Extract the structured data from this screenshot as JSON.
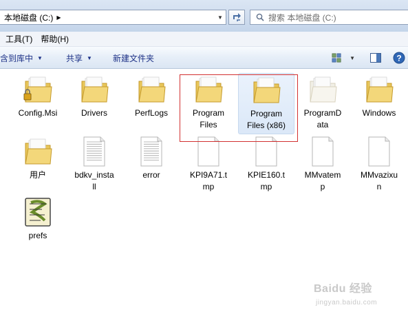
{
  "address": {
    "path": "本地磁盘 (C:)",
    "search_placeholder": "搜索 本地磁盘 (C:)"
  },
  "menu": {
    "items": [
      {
        "label": "工具(T)"
      },
      {
        "label": "帮助(H)"
      }
    ]
  },
  "toolbar": {
    "include_label": "包含到库中",
    "share_label": "共享",
    "new_folder_label": "新建文件夹"
  },
  "files": [
    {
      "name": "Config.Msi",
      "type": "folder-locked"
    },
    {
      "name": "Drivers",
      "type": "folder"
    },
    {
      "name": "PerfLogs",
      "type": "folder"
    },
    {
      "name": "Program\nFiles",
      "type": "folder"
    },
    {
      "name": "Program\nFiles (x86)",
      "type": "folder",
      "selected": true
    },
    {
      "name": "ProgramD\nata",
      "type": "folder-faded"
    },
    {
      "name": "Windows",
      "type": "folder"
    },
    {
      "name": "用户",
      "type": "folder"
    },
    {
      "name": "bdkv_insta\nll",
      "type": "document"
    },
    {
      "name": "error",
      "type": "document"
    },
    {
      "name": "KPI9A71.t\nmp",
      "type": "blank"
    },
    {
      "name": "KPIE160.t\nmp",
      "type": "blank"
    },
    {
      "name": "MMvatem\np",
      "type": "blank"
    },
    {
      "name": "MMvazixu\nn",
      "type": "blank"
    },
    {
      "name": "prefs",
      "type": "script"
    }
  ],
  "watermark": {
    "text": "Baidu 经验",
    "sub": "jingyan.baidu.com"
  }
}
